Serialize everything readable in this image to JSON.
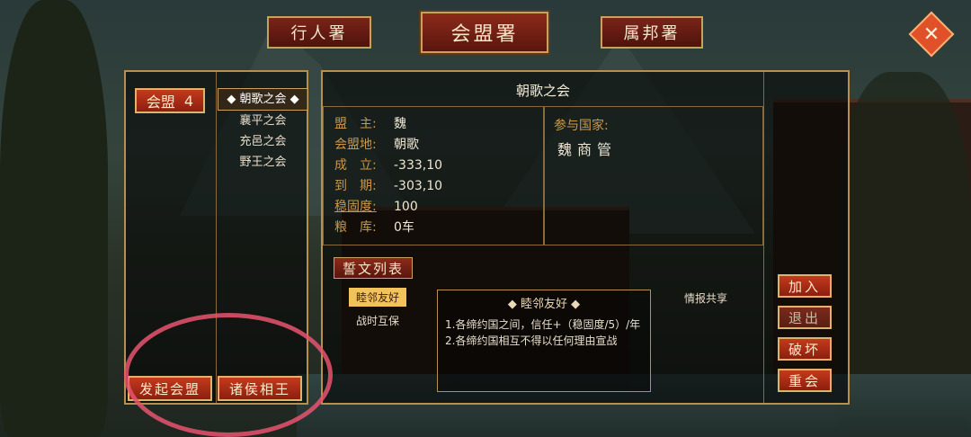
{
  "tabs": [
    {
      "label": "行人署",
      "active": false
    },
    {
      "label": "会盟署",
      "active": true
    },
    {
      "label": "属邦署",
      "active": false
    }
  ],
  "close_icon": "close-icon",
  "left": {
    "alliance_label": "会盟",
    "alliance_count": "4",
    "list": [
      "朝歌之会",
      "襄平之会",
      "充邑之会",
      "野王之会"
    ],
    "selected_index": 0,
    "launch_button": "发起会盟",
    "princes_button": "诸侯相王"
  },
  "detail": {
    "title": "朝歌之会",
    "fields": [
      {
        "key": "盟　主:",
        "value": "魏"
      },
      {
        "key": "会盟地:",
        "value": "朝歌"
      },
      {
        "key": "成　立:",
        "value": "-333,10"
      },
      {
        "key": "到　期:",
        "value": "-303,10"
      },
      {
        "key": "稳固度:",
        "value": "100"
      },
      {
        "key": "粮　库:",
        "value": "0车"
      }
    ],
    "members_label": "参与国家:",
    "members": "魏商管"
  },
  "oath": {
    "header": "誓文列表",
    "tags": [
      "睦邻友好",
      "战时互保",
      "情报共享"
    ],
    "selected_tag": "睦邻友好",
    "detail_title": "睦邻友好",
    "lines": [
      "1.各缔约国之间，信任+（稳固度/5）/年",
      "2.各缔约国相互不得以任何理由宣战"
    ]
  },
  "actions": [
    {
      "label": "加入",
      "enabled": true
    },
    {
      "label": "退出",
      "enabled": false
    },
    {
      "label": "破坏",
      "enabled": true
    },
    {
      "label": "重会",
      "enabled": true
    }
  ],
  "colors": {
    "accent": "#c9a262",
    "button_red": "#b8321a",
    "annotation": "#e8536f"
  }
}
